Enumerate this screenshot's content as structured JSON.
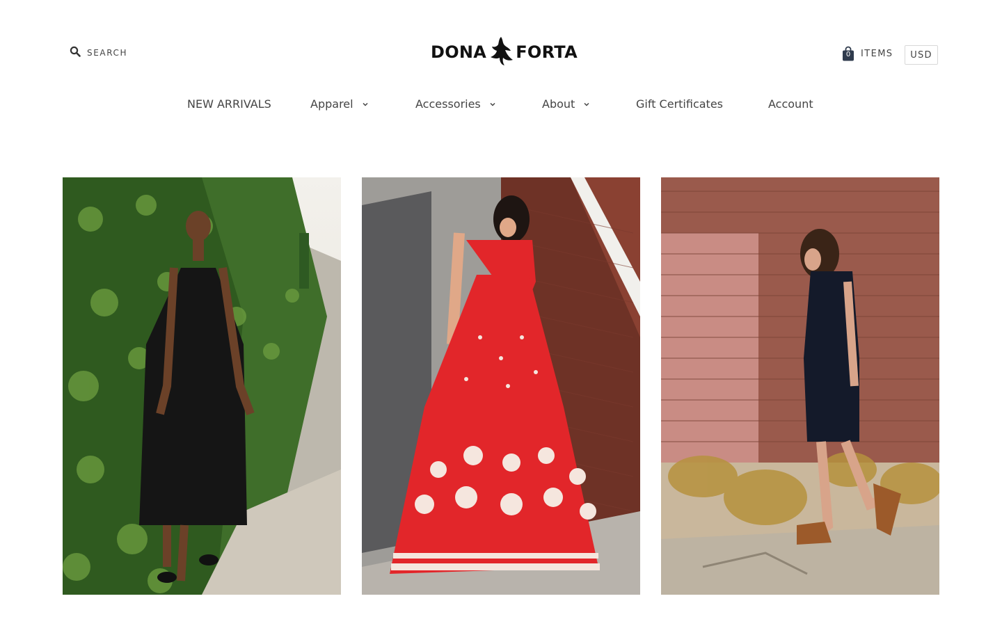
{
  "header": {
    "search_label": "SEARCH",
    "logo_left": "DONA",
    "logo_right": "FORTA",
    "cart_count": "0",
    "cart_label": "ITEMS",
    "currency": "USD"
  },
  "nav": {
    "items": [
      {
        "label": "NEW ARRIVALS",
        "has_dropdown": false
      },
      {
        "label": "Apparel",
        "has_dropdown": true
      },
      {
        "label": "Accessories",
        "has_dropdown": true
      },
      {
        "label": "About",
        "has_dropdown": true
      },
      {
        "label": "Gift Certificates",
        "has_dropdown": false
      },
      {
        "label": "Account",
        "has_dropdown": false
      }
    ]
  },
  "gallery": {
    "tiles": [
      {
        "description": "woman in black dress beside ivy wall",
        "dress_color": "#151515"
      },
      {
        "description": "woman in red floral maxi dress by brick wall",
        "dress_color": "#e2262a"
      },
      {
        "description": "woman in navy dress walking past brick wall",
        "dress_color": "#141a2a"
      }
    ]
  },
  "colors": {
    "text": "#444444",
    "logo": "#111111",
    "border": "#d8d8d8"
  }
}
